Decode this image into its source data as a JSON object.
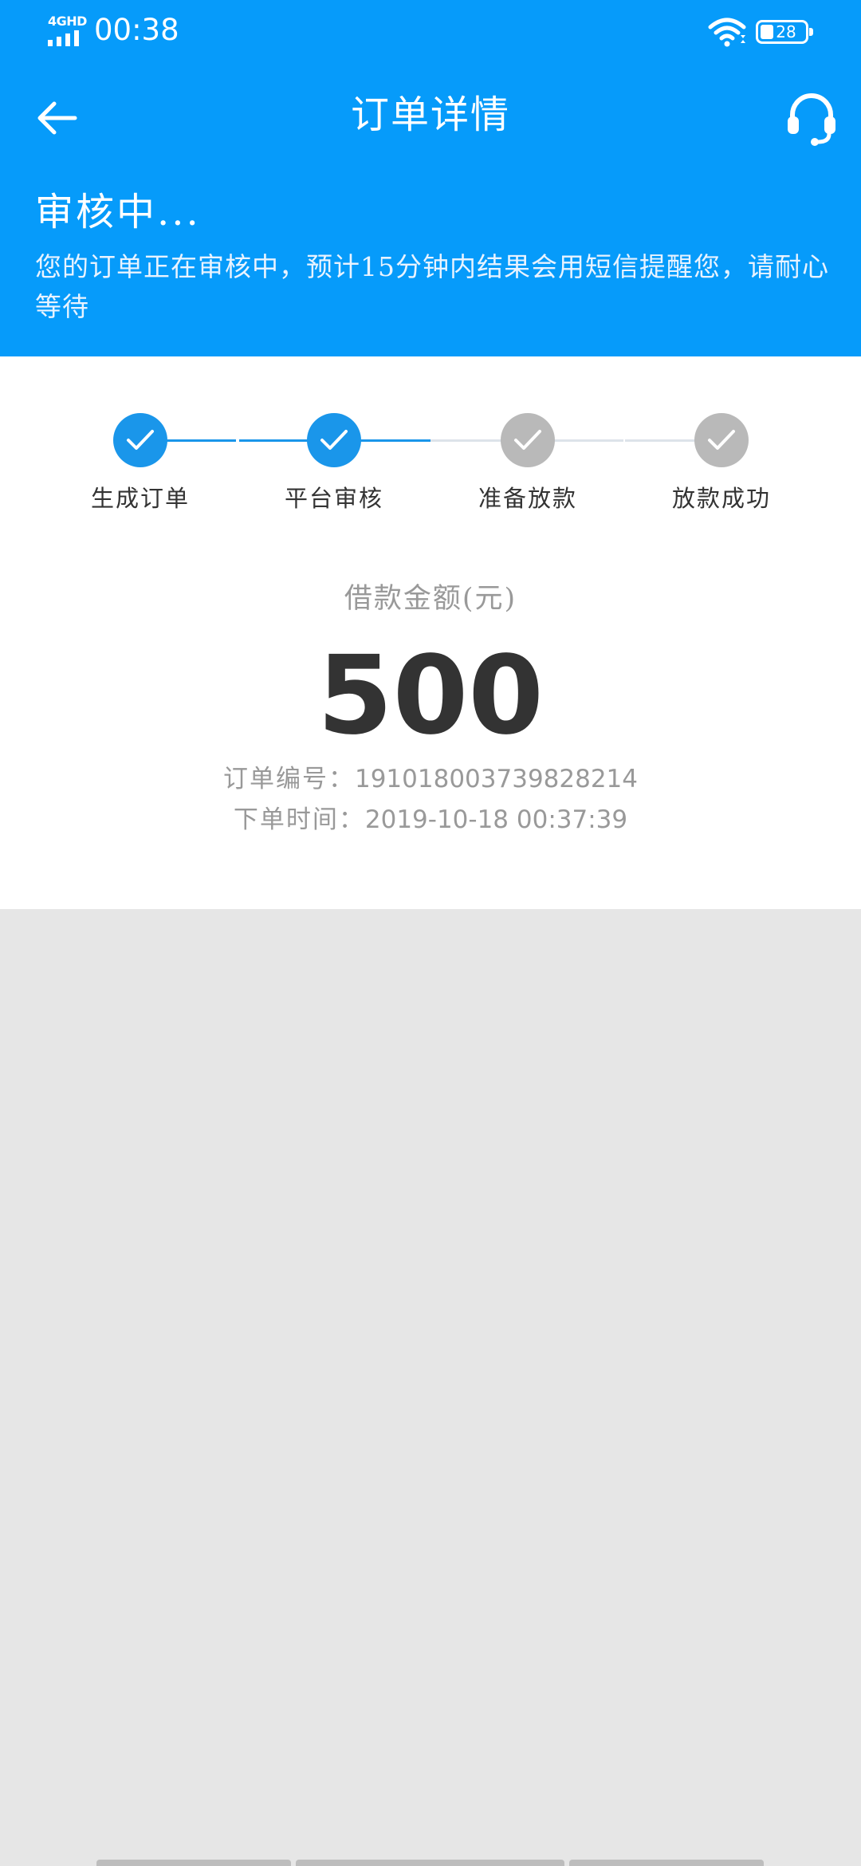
{
  "status_bar": {
    "network": "4GHD",
    "time": "00:38",
    "battery": "28"
  },
  "header": {
    "title": "订单详情",
    "icons": [
      "back-arrow-icon",
      "customer-service-headset-icon"
    ]
  },
  "status": {
    "title": "审核中...",
    "description": "您的订单正在审核中，预计15分钟内结果会用短信提醒您，请耐心等待"
  },
  "steps": [
    {
      "label": "生成订单",
      "done": true
    },
    {
      "label": "平台审核",
      "done": true
    },
    {
      "label": "准备放款",
      "done": false
    },
    {
      "label": "放款成功",
      "done": false
    }
  ],
  "loan": {
    "amount_label": "借款金额(元)",
    "amount": "500",
    "order_no_label": "订单编号：",
    "order_no": "1910180037398282​14",
    "order_time_label": "下单时间：",
    "order_time": "2019-10-18 00:37:39"
  },
  "colors": {
    "primary": "#069bfa",
    "step_active": "#1a96ea",
    "step_inactive": "#b9b9b9",
    "background": "#e6e6e6"
  }
}
